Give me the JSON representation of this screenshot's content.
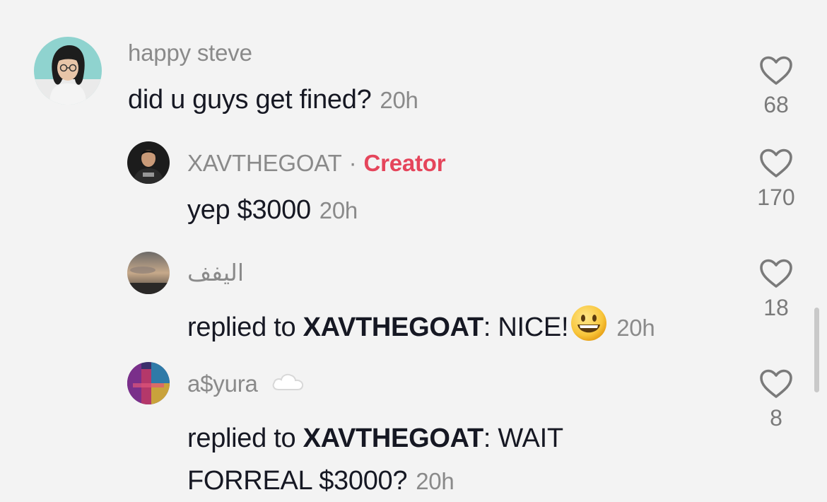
{
  "comments": [
    {
      "username": "happy steve",
      "text": "did u guys get fined?",
      "time": "20h",
      "likes": "68",
      "avatar_icon": "avatar-photo-girl"
    },
    {
      "username": "XAVTHEGOAT",
      "separator": "·",
      "badge": "Creator",
      "text": "yep $3000",
      "time": "20h",
      "likes": "170",
      "avatar_icon": "avatar-photo-man"
    },
    {
      "username": "اليفف",
      "reply_prefix": "replied to ",
      "reply_to": "XAVTHEGOAT",
      "reply_text": ": NICE!",
      "emoji": "smiley-emoji",
      "time": "20h",
      "likes": "18",
      "avatar_icon": "avatar-photo-sky"
    },
    {
      "username": "a$yura",
      "username_icon": "cloud-icon",
      "reply_prefix": "replied to ",
      "reply_to": "XAVTHEGOAT",
      "reply_text_line1": ": WAIT",
      "reply_text_line2": "FORREAL $3000?",
      "time": "20h",
      "likes": "8",
      "avatar_icon": "avatar-photo-colorful"
    }
  ],
  "colors": {
    "background": "#f3f3f3",
    "creator_badge": "#e5455b",
    "muted": "#8a8a8a",
    "text": "#161823"
  }
}
